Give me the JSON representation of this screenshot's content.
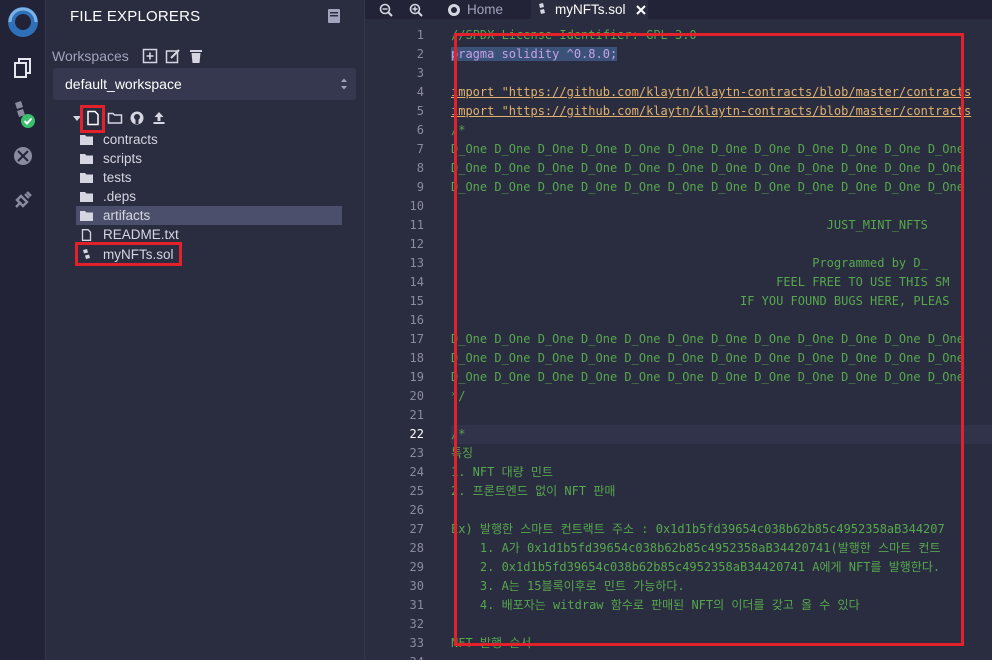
{
  "iconbar": {
    "items": [
      {
        "name": "remix-logo-icon"
      },
      {
        "name": "file-explorer-icon"
      },
      {
        "name": "solidity-compiler-icon"
      },
      {
        "name": "deploy-run-icon"
      },
      {
        "name": "plugin-manager-icon"
      }
    ]
  },
  "sidebar": {
    "title": "FILE EXPLORERS",
    "workspaces_label": "Workspaces",
    "workspace_value": "default_workspace",
    "tree": [
      {
        "label": "contracts",
        "type": "folder"
      },
      {
        "label": "scripts",
        "type": "folder"
      },
      {
        "label": "tests",
        "type": "folder"
      },
      {
        "label": ".deps",
        "type": "folder"
      },
      {
        "label": "artifacts",
        "type": "folder",
        "selected": true
      },
      {
        "label": "README.txt",
        "type": "file"
      },
      {
        "label": "myNFTs.sol",
        "type": "solidity"
      }
    ]
  },
  "tabs": {
    "home": "Home",
    "active": "myNFTs.sol"
  },
  "editor": {
    "current_line": 22,
    "lines": [
      {
        "n": "1",
        "text": "//SPDX-License-Identifier: GPL-3.0",
        "cls": "c-comment"
      },
      {
        "n": "2",
        "text": "pragma solidity ^0.8.0;",
        "cls": "c-plain"
      },
      {
        "n": "3",
        "text": "",
        "cls": "c-plain"
      },
      {
        "n": "4",
        "text": "import \"https://github.com/klaytn/klaytn-contracts/blob/master/contracts",
        "cls": "c-plain"
      },
      {
        "n": "5",
        "text": "import \"https://github.com/klaytn/klaytn-contracts/blob/master/contracts",
        "cls": "c-plain"
      },
      {
        "n": "6",
        "text": "/*",
        "cls": "c-comment"
      },
      {
        "n": "7",
        "text": "D_One D_One D_One D_One D_One D_One D_One D_One D_One D_One D_One D_One",
        "cls": "c-comment"
      },
      {
        "n": "8",
        "text": "D_One D_One D_One D_One D_One D_One D_One D_One D_One D_One D_One D_One",
        "cls": "c-comment"
      },
      {
        "n": "9",
        "text": "D_One D_One D_One D_One D_One D_One D_One D_One D_One D_One D_One D_One",
        "cls": "c-comment"
      },
      {
        "n": "10",
        "text": "",
        "cls": "c-comment"
      },
      {
        "n": "11",
        "text": "                                                    JUST_MINT_NFTS",
        "cls": "c-comment"
      },
      {
        "n": "12",
        "text": "",
        "cls": "c-comment"
      },
      {
        "n": "13",
        "text": "                                                  Programmed by D_",
        "cls": "c-comment"
      },
      {
        "n": "14",
        "text": "                                             FEEL FREE TO USE THIS SM",
        "cls": "c-comment"
      },
      {
        "n": "15",
        "text": "                                        IF YOU FOUND BUGS HERE, PLEAS",
        "cls": "c-comment"
      },
      {
        "n": "16",
        "text": "",
        "cls": "c-comment"
      },
      {
        "n": "17",
        "text": "D_One D_One D_One D_One D_One D_One D_One D_One D_One D_One D_One D_One",
        "cls": "c-comment"
      },
      {
        "n": "18",
        "text": "D_One D_One D_One D_One D_One D_One D_One D_One D_One D_One D_One D_One",
        "cls": "c-comment"
      },
      {
        "n": "19",
        "text": "D_One D_One D_One D_One D_One D_One D_One D_One D_One D_One D_One D_One",
        "cls": "c-comment"
      },
      {
        "n": "20",
        "text": "*/",
        "cls": "c-comment"
      },
      {
        "n": "21",
        "text": "",
        "cls": "c-comment"
      },
      {
        "n": "22",
        "text": "/*",
        "cls": "c-comment"
      },
      {
        "n": "23",
        "text": "특징",
        "cls": "c-comment"
      },
      {
        "n": "24",
        "text": "1. NFT 대량 민트",
        "cls": "c-comment"
      },
      {
        "n": "25",
        "text": "2. 프론트엔드 없이 NFT 판매",
        "cls": "c-comment"
      },
      {
        "n": "26",
        "text": "",
        "cls": "c-comment"
      },
      {
        "n": "27",
        "text": "Ex) 발행한 스마트 컨트랙트 주소 : 0x1d1b5fd39654c038b62b85c4952358aB344207",
        "cls": "c-comment"
      },
      {
        "n": "28",
        "text": "    1. A가 0x1d1b5fd39654c038b62b85c4952358aB34420741(발행한 스마트 컨트",
        "cls": "c-comment"
      },
      {
        "n": "29",
        "text": "    2. 0x1d1b5fd39654c038b62b85c4952358aB34420741 A에게 NFT를 발행한다.",
        "cls": "c-comment"
      },
      {
        "n": "30",
        "text": "    3. A는 15블록이후로 민트 가능하다.",
        "cls": "c-comment"
      },
      {
        "n": "31",
        "text": "    4. 배포자는 witdraw 함수로 판매된 NFT의 이더를 갖고 올 수 있다",
        "cls": "c-comment"
      },
      {
        "n": "32",
        "text": "",
        "cls": "c-comment"
      },
      {
        "n": "33",
        "text": "NFT 발행 순서",
        "cls": "c-comment"
      },
      {
        "n": "34",
        "text": "",
        "cls": "c-comment"
      }
    ]
  },
  "colors": {
    "highlight_box": "#e3212b",
    "comment": "#56a74e",
    "accent": "#5a8bd6"
  }
}
